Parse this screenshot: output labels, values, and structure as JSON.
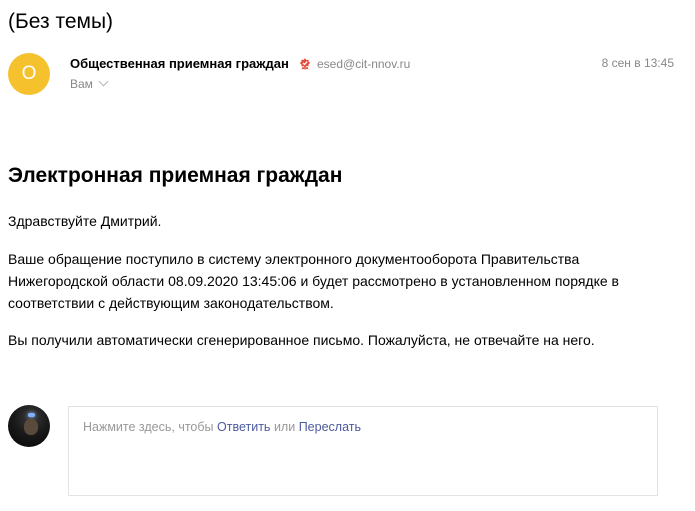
{
  "subject": "(Без темы)",
  "sender": {
    "avatar_letter": "О",
    "avatar_color": "#f5c22e",
    "name": "Общественная приемная граждан",
    "email": "esed@cit-nnov.ru",
    "date": "8 сен в 13:45",
    "recipient": "Вам"
  },
  "body": {
    "heading": "Электронная приемная граждан",
    "paragraphs": [
      "Здравствуйте Дмитрий.",
      "Ваше обращение поступило в систему электронного документооборота Правительства Нижегородской области 08.09.2020 13:45:06 и будет рассмотрено в установленном порядке в соответствии с действующим законодательством.",
      "Вы получили автоматически сгенерированное письмо. Пожалуйста, не отвечайте на него."
    ]
  },
  "reply": {
    "prefix": "Нажмите здесь, чтобы",
    "reply_link": "Ответить",
    "separator": "или",
    "forward_link": "Переслать",
    "link_color": "#4b5a9e"
  },
  "icons": {
    "verify": "verified-sender-icon",
    "chevron": "chevron-down-icon"
  }
}
